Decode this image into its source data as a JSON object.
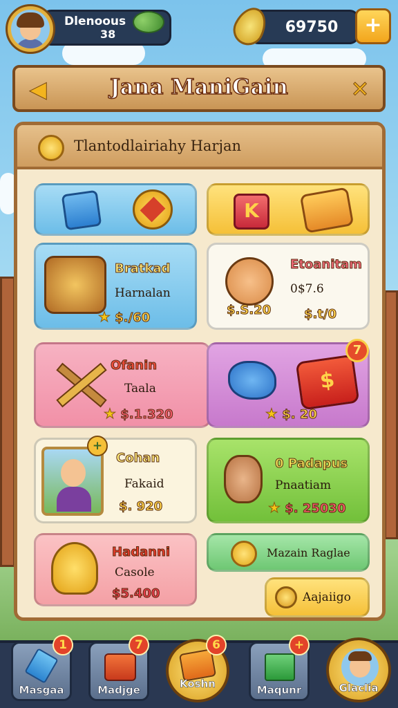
{
  "player": {
    "name": "Dlenoous",
    "level": "38"
  },
  "currency": {
    "amount": "69750",
    "add_label": "+"
  },
  "title": {
    "text": "Jana ManiGain",
    "left_arrow": "◀",
    "right_arrow": "✕"
  },
  "board": {
    "header": "Tlantodlairiahy Harjan"
  },
  "cards": [
    {
      "name": "Bratkad",
      "sub": "Harnalan",
      "price": "$./60"
    },
    {
      "name": "Etoanitam",
      "sub": "0$7.6",
      "price": "$.S.20",
      "price2": "$.t/0"
    },
    {
      "name": "Ofanin",
      "sub": "Taala",
      "price": "$.1.320"
    },
    {
      "price": "$. 20",
      "badge": "7"
    },
    {
      "name": "Cohan",
      "sub": "Fakaid",
      "price": "$. 920"
    },
    {
      "name": "0 Padapus",
      "sub": "Pnaatiam",
      "price": "$. 25030"
    },
    {
      "name": "Hadanni",
      "sub": "Casole",
      "price": "$5.400"
    },
    {
      "name": "Mazain Raglae"
    },
    {
      "name": "Aajaiigo"
    }
  ],
  "top_icons": {
    "k_label": "K"
  },
  "nav": [
    {
      "label": "Masgaa",
      "badge": "1"
    },
    {
      "label": "Madjge",
      "badge": "7"
    },
    {
      "label": "Koshn",
      "badge": "6"
    },
    {
      "label": "Maqunr",
      "badge": "+"
    },
    {
      "label": "Glaclia"
    }
  ],
  "colors": {
    "board": "#f6e9cd",
    "wood": "#a06b35",
    "navbar": "#2a3852",
    "accent": "#f5c038"
  }
}
